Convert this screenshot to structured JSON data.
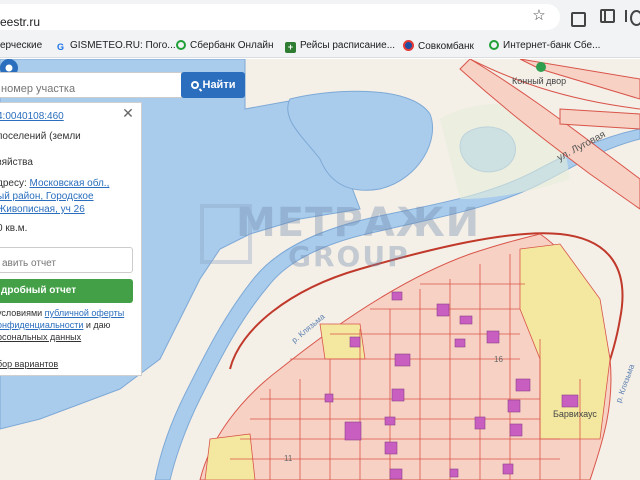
{
  "browser": {
    "url": "eestr.ru",
    "bookmarks": [
      {
        "label": "ерческие",
        "icon": "bookmark-icon"
      },
      {
        "label": "GISMETEO.RU: Пого...",
        "icon": "gismeteo-icon"
      },
      {
        "label": "Сбербанк Онлайн",
        "icon": "sber-icon"
      },
      {
        "label": "Рейсы расписание...",
        "icon": "plus-icon"
      },
      {
        "label": "Совкомбанк",
        "icon": "sovcombank-icon"
      },
      {
        "label": "Интернет-банк Сбе...",
        "icon": "sber-icon"
      }
    ]
  },
  "search": {
    "placeholder": "номер участка",
    "button_label": "Найти"
  },
  "panel": {
    "cadastral_number": "4:0040108:460",
    "category": "поселений (земли",
    "purpose": "зяйства",
    "address_prefix": "дресу:",
    "address_line1": "Московская обл.,",
    "address_line2": "ый район, Городское",
    "address_line3": "Живописная, уч 26",
    "area": "0 кв.м.",
    "report_placeholder": "авить отчет",
    "report_button": "дробный отчет",
    "terms_line1_prefix": "условиями ",
    "terms_link1": "публичной оферты",
    "terms_link2": "онфиденциальности",
    "terms_line2_suffix": " и даю",
    "terms_link3": "рсональных данных",
    "variants_link": "бор вариантов"
  },
  "map": {
    "watermark_line1": "МЕТРАЖИ",
    "watermark_line2": "GROUP",
    "street": "ул. Луговая",
    "river1": "р. Клязьма",
    "river2": "р. Клязьма",
    "place1": "Конный двор",
    "place2": "Барвихаус",
    "parcel_no": "11",
    "parcel_no2": "16"
  },
  "colors": {
    "water": "#a9ccec",
    "parcel_fill": "#f7d2c4",
    "parcel_border": "#d9544a",
    "yellow_zone": "#f4e8a0",
    "building": "#c85fc0",
    "accent_button": "#2a6ebd",
    "report_button": "#43a047"
  }
}
